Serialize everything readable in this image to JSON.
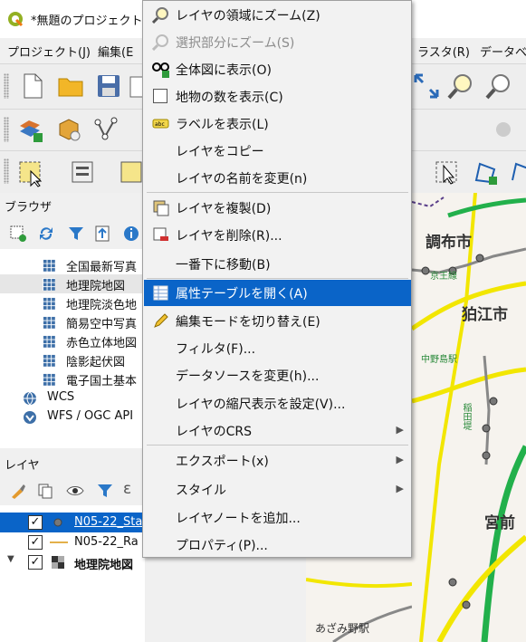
{
  "window": {
    "title": "*無題のプロジェクト -"
  },
  "menubar": {
    "items": [
      "プロジェクト(J)",
      "編集(E",
      "ラスタ(R)",
      "データベー"
    ]
  },
  "browser_panel": {
    "title": "ブラウザ",
    "items": [
      "全国最新写真",
      "地理院地図",
      "地理院淡色地",
      "簡易空中写真",
      "赤色立体地図",
      "陰影起伏図",
      "電子国土基本",
      "WCS",
      "WFS / OGC API"
    ]
  },
  "layers_panel": {
    "title": "レイヤ",
    "layers": [
      {
        "name": "N05-22_Sta",
        "checked": true,
        "selected": true
      },
      {
        "name": "N05-22_Ra",
        "checked": true,
        "selected": false
      },
      {
        "name": "地理院地図",
        "checked": true,
        "selected": false
      }
    ]
  },
  "context_menu": {
    "items": [
      {
        "label": "レイヤの領域にズーム(Z)",
        "icon": "zoom-icon"
      },
      {
        "label": "選択部分にズーム(S)",
        "icon": "zoom-disabled-icon",
        "disabled": true
      },
      {
        "label": "全体図に表示(O)",
        "icon": "overview-icon"
      },
      {
        "label": "地物の数を表示(C)",
        "icon": "checkbox-icon"
      },
      {
        "label": "ラベルを表示(L)",
        "icon": "label-icon"
      },
      {
        "label": "レイヤをコピー"
      },
      {
        "label": "レイヤの名前を変更(n)"
      },
      {
        "label": "レイヤを複製(D)",
        "icon": "duplicate-icon"
      },
      {
        "label": "レイヤを削除(R)...",
        "icon": "remove-icon"
      },
      {
        "label": "一番下に移動(B)"
      },
      {
        "label": "属性テーブルを開く(A)",
        "icon": "table-icon",
        "active": true
      },
      {
        "label": "編集モードを切り替え(E)",
        "icon": "pencil-icon"
      },
      {
        "label": "フィルタ(F)..."
      },
      {
        "label": "データソースを変更(h)..."
      },
      {
        "label": "レイヤの縮尺表示を設定(V)..."
      },
      {
        "label": "レイヤのCRS",
        "submenu": true
      },
      {
        "label": "エクスポート(x)",
        "submenu": true
      },
      {
        "label": "スタイル",
        "submenu": true
      },
      {
        "label": "レイヤノートを追加..."
      },
      {
        "label": "プロパティ(P)..."
      }
    ]
  },
  "map_labels": [
    "調布市",
    "狛江市",
    "宮前",
    "あざみ野駅",
    "京王線",
    "中野島駅",
    "稲田堤"
  ],
  "colors": {
    "accent": "#0a64c8",
    "road_yellow": "#f2e600",
    "rail_green": "#22b04b"
  }
}
